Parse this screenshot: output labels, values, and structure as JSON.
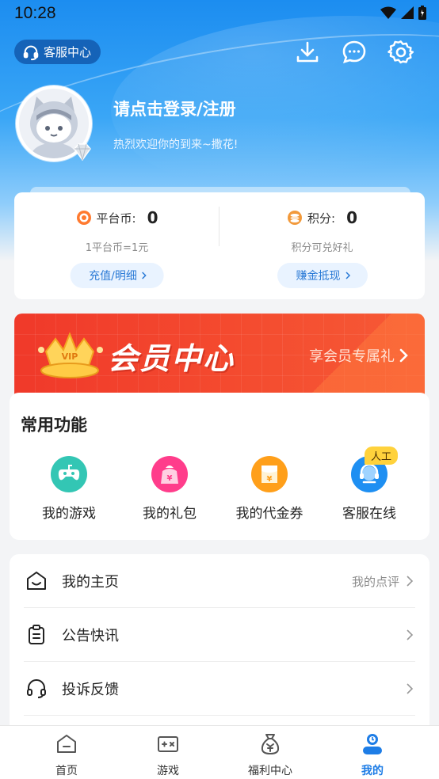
{
  "status_bar": {
    "time": "10:28"
  },
  "header": {
    "customer_service_label": "客服中心",
    "login_prompt": "请点击登录/注册",
    "welcome": "热烈欢迎你的到来~撒花!"
  },
  "coins": {
    "platform": {
      "label": "平台币:",
      "value": "0",
      "note": "1平台币=1元",
      "button": "充值/明细"
    },
    "points": {
      "label": "积分:",
      "value": "0",
      "note": "积分可兑好礼",
      "button": "赚金抵现"
    }
  },
  "vip_banner": {
    "title": "会员中心",
    "link": "享会员专属礼",
    "badge_text": "VIP"
  },
  "functions": {
    "title": "常用功能",
    "items": [
      {
        "label": "我的游戏",
        "icon": "gamepad-icon",
        "color": "#33c6b4"
      },
      {
        "label": "我的礼包",
        "icon": "gift-bag-icon",
        "color": "#ff3d8b"
      },
      {
        "label": "我的代金券",
        "icon": "voucher-icon",
        "color": "#ff9f1a"
      },
      {
        "label": "客服在线",
        "icon": "headset-icon",
        "color": "#1e8ff2",
        "tag": "人工"
      }
    ]
  },
  "menu": {
    "items": [
      {
        "label": "我的主页",
        "extra": "我的点评",
        "icon": "home-smile-icon"
      },
      {
        "label": "公告快讯",
        "extra": "",
        "icon": "clipboard-icon"
      },
      {
        "label": "投诉反馈",
        "extra": "",
        "icon": "headphones-icon"
      }
    ]
  },
  "bottom_nav": {
    "items": [
      {
        "label": "首页",
        "icon": "home-icon"
      },
      {
        "label": "游戏",
        "icon": "game-icon"
      },
      {
        "label": "福利中心",
        "icon": "money-bag-icon"
      },
      {
        "label": "我的",
        "icon": "profile-icon",
        "active": true
      }
    ]
  },
  "colors": {
    "accent": "#1e7de6",
    "banner_red": "#f0392a",
    "header_blue": "#1c8df0"
  }
}
